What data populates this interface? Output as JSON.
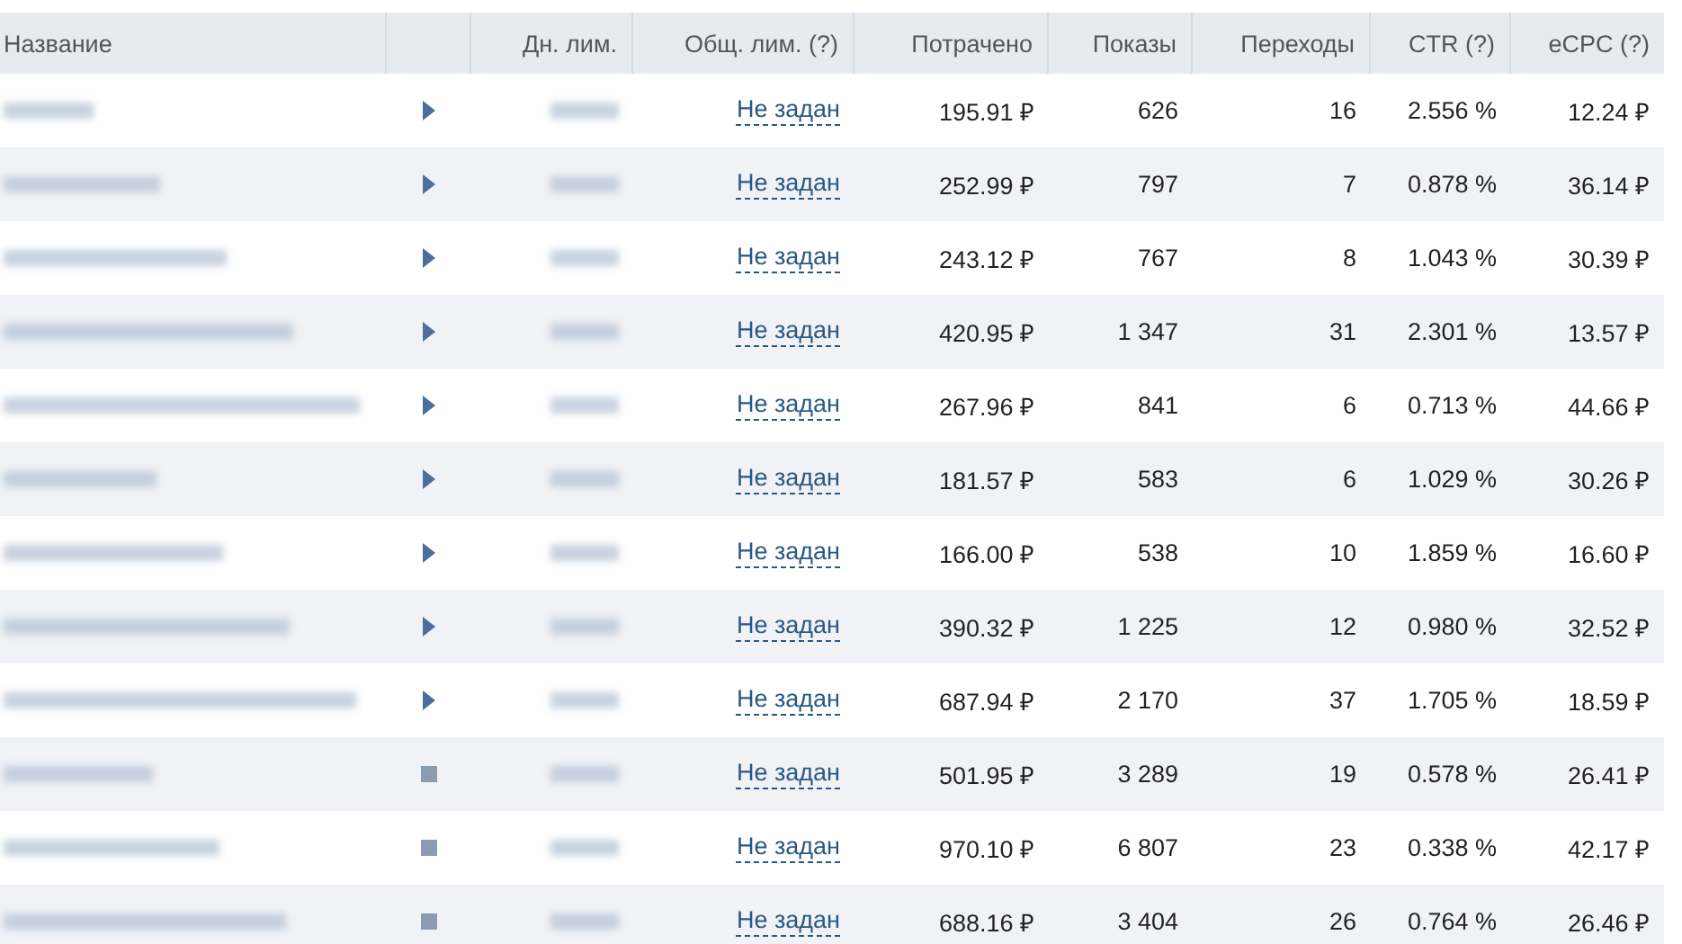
{
  "table": {
    "columns": [
      "Название",
      "",
      "Дн. лим.",
      "Общ. лим. (?)",
      "Потрачено",
      "Показы",
      "Переходы",
      "CTR (?)",
      "eCPC (?)"
    ],
    "rows": [
      {
        "running": true,
        "total_limit": "Не задан",
        "spent": "195.91 ₽",
        "impressions": "626",
        "clicks": "16",
        "ctr": "2.556 %",
        "ecpc": "12.24 ₽"
      },
      {
        "running": true,
        "total_limit": "Не задан",
        "spent": "252.99 ₽",
        "impressions": "797",
        "clicks": "7",
        "ctr": "0.878 %",
        "ecpc": "36.14 ₽"
      },
      {
        "running": true,
        "total_limit": "Не задан",
        "spent": "243.12 ₽",
        "impressions": "767",
        "clicks": "8",
        "ctr": "1.043 %",
        "ecpc": "30.39 ₽"
      },
      {
        "running": true,
        "total_limit": "Не задан",
        "spent": "420.95 ₽",
        "impressions": "1 347",
        "clicks": "31",
        "ctr": "2.301 %",
        "ecpc": "13.57 ₽"
      },
      {
        "running": true,
        "total_limit": "Не задан",
        "spent": "267.96 ₽",
        "impressions": "841",
        "clicks": "6",
        "ctr": "0.713 %",
        "ecpc": "44.66 ₽"
      },
      {
        "running": true,
        "total_limit": "Не задан",
        "spent": "181.57 ₽",
        "impressions": "583",
        "clicks": "6",
        "ctr": "1.029 %",
        "ecpc": "30.26 ₽"
      },
      {
        "running": true,
        "total_limit": "Не задан",
        "spent": "166.00 ₽",
        "impressions": "538",
        "clicks": "10",
        "ctr": "1.859 %",
        "ecpc": "16.60 ₽"
      },
      {
        "running": true,
        "total_limit": "Не задан",
        "spent": "390.32 ₽",
        "impressions": "1 225",
        "clicks": "12",
        "ctr": "0.980 %",
        "ecpc": "32.52 ₽"
      },
      {
        "running": true,
        "total_limit": "Не задан",
        "spent": "687.94 ₽",
        "impressions": "2 170",
        "clicks": "37",
        "ctr": "1.705 %",
        "ecpc": "18.59 ₽"
      },
      {
        "running": false,
        "total_limit": "Не задан",
        "spent": "501.95 ₽",
        "impressions": "3 289",
        "clicks": "19",
        "ctr": "0.578 %",
        "ecpc": "26.41 ₽"
      },
      {
        "running": false,
        "total_limit": "Не задан",
        "spent": "970.10 ₽",
        "impressions": "6 807",
        "clicks": "23",
        "ctr": "0.338 %",
        "ecpc": "42.17 ₽"
      },
      {
        "running": false,
        "total_limit": "Не задан",
        "spent": "688.16 ₽",
        "impressions": "3 404",
        "clicks": "26",
        "ctr": "0.764 %",
        "ecpc": "26.46 ₽"
      }
    ]
  }
}
